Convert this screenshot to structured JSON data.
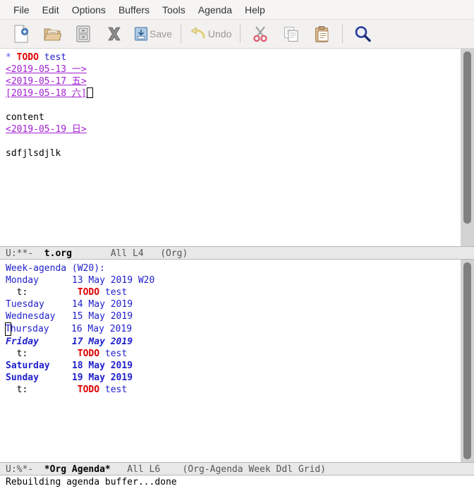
{
  "menu": {
    "items": [
      {
        "label": "File",
        "name": "menu-file"
      },
      {
        "label": "Edit",
        "name": "menu-edit"
      },
      {
        "label": "Options",
        "name": "menu-options"
      },
      {
        "label": "Buffers",
        "name": "menu-buffers"
      },
      {
        "label": "Tools",
        "name": "menu-tools"
      },
      {
        "label": "Agenda",
        "name": "menu-agenda"
      },
      {
        "label": "Help",
        "name": "menu-help"
      }
    ]
  },
  "toolbar": {
    "new_file_icon": "new-file-icon",
    "open_file_icon": "open-folder-icon",
    "save_as_icon": "file-cabinet-icon",
    "close_icon": "close-x-icon",
    "save_icon": "save-icon",
    "save_label": "Save",
    "undo_icon": "undo-arrow-icon",
    "undo_label": "Undo",
    "cut_icon": "scissors-icon",
    "copy_icon": "copy-icon",
    "paste_icon": "clipboard-paste-icon",
    "search_icon": "magnifier-icon"
  },
  "org_buffer": {
    "headline": {
      "bullet": "*",
      "todo": "TODO",
      "title": "test"
    },
    "timestamps": [
      "<2019-05-13 一>",
      "<2019-05-17 五>",
      "[2019-05-18 六]"
    ],
    "body": [
      "content"
    ],
    "body_timestamp": "<2019-05-19 日>",
    "trailing_text": "sdfjlsdjlk",
    "modeline": {
      "coding": "U:**-",
      "buffer": "t.org",
      "position": "All L4",
      "mode": "(Org)"
    }
  },
  "agenda_buffer": {
    "title": "Week-agenda (W20):",
    "days": [
      {
        "name": "Monday",
        "date": "13 May 2019 W20",
        "style": "normal",
        "entries": [
          {
            "category": "t:",
            "todo": "TODO",
            "text": "test"
          }
        ]
      },
      {
        "name": "Tuesday",
        "date": "14 May 2019",
        "style": "normal",
        "entries": []
      },
      {
        "name": "Wednesday",
        "date": "15 May 2019",
        "style": "normal",
        "entries": []
      },
      {
        "name": "Thursday",
        "date": "16 May 2019",
        "style": "cursor",
        "entries": []
      },
      {
        "name": "Friday",
        "date": "17 May 2019",
        "style": "today",
        "entries": [
          {
            "category": "t:",
            "todo": "TODO",
            "text": "test"
          }
        ]
      },
      {
        "name": "Saturday",
        "date": "18 May 2019",
        "style": "weekend",
        "entries": []
      },
      {
        "name": "Sunday",
        "date": "19 May 2019",
        "style": "weekend",
        "entries": [
          {
            "category": "t:",
            "todo": "TODO",
            "text": "test"
          }
        ]
      }
    ],
    "modeline": {
      "coding": "U:%*-",
      "buffer": "*Org Agenda*",
      "position": "All L6",
      "mode": "(Org-Agenda Week Ddl Grid)"
    }
  },
  "echo_area": {
    "message": "Rebuilding agenda buffer...done"
  },
  "colors": {
    "todo_red": "#dd0000",
    "org_link_purple": "#a020d0",
    "agenda_blue": "#2020cc",
    "headline_blue": "#5555ff",
    "modeline_bg": "#e8e8e8",
    "toolbar_bg": "#f2f1f0",
    "menubar_bg": "#f6f5f4"
  }
}
